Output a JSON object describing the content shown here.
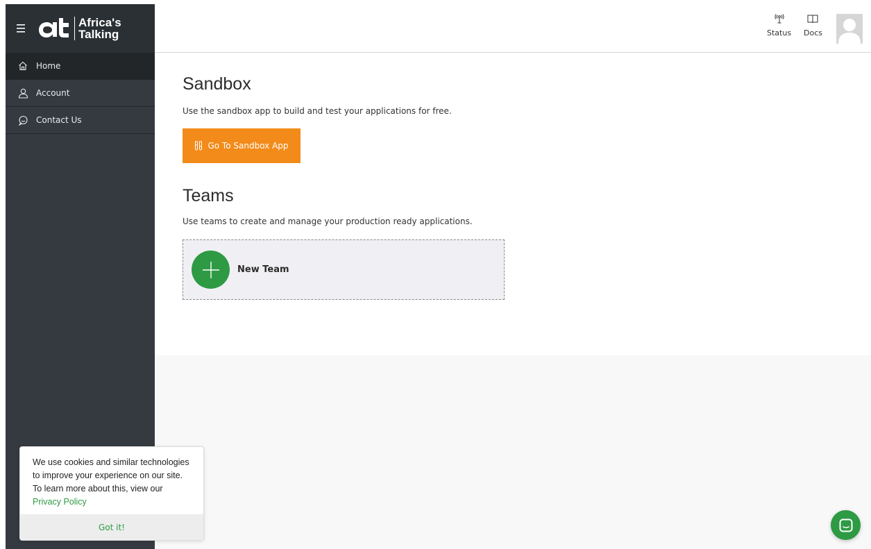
{
  "brand": {
    "name_line1": "Africa's",
    "name_line2": "Talking"
  },
  "sidebar": {
    "items": [
      {
        "label": "Home",
        "icon": "home-icon",
        "active": true
      },
      {
        "label": "Account",
        "icon": "user-icon",
        "active": false
      },
      {
        "label": "Contact Us",
        "icon": "chat-bubble-icon",
        "active": false
      }
    ]
  },
  "header": {
    "status_label": "Status",
    "docs_label": "Docs"
  },
  "sandbox": {
    "title": "Sandbox",
    "description": "Use the sandbox app to build and test your applications for free.",
    "button_label": "Go To Sandbox App"
  },
  "teams": {
    "title": "Teams",
    "description": "Use teams to create and manage your production ready applications.",
    "new_team_label": "New Team"
  },
  "cookie": {
    "text": "We use cookies and similar technologies to improve your experience on our site. To learn more about this, view our",
    "link_label": "Privacy Policy",
    "button_label": "Got it!"
  },
  "colors": {
    "sidebar_bg": "#343a40",
    "accent_orange": "#f38b1a",
    "accent_green": "#2e9a44"
  }
}
